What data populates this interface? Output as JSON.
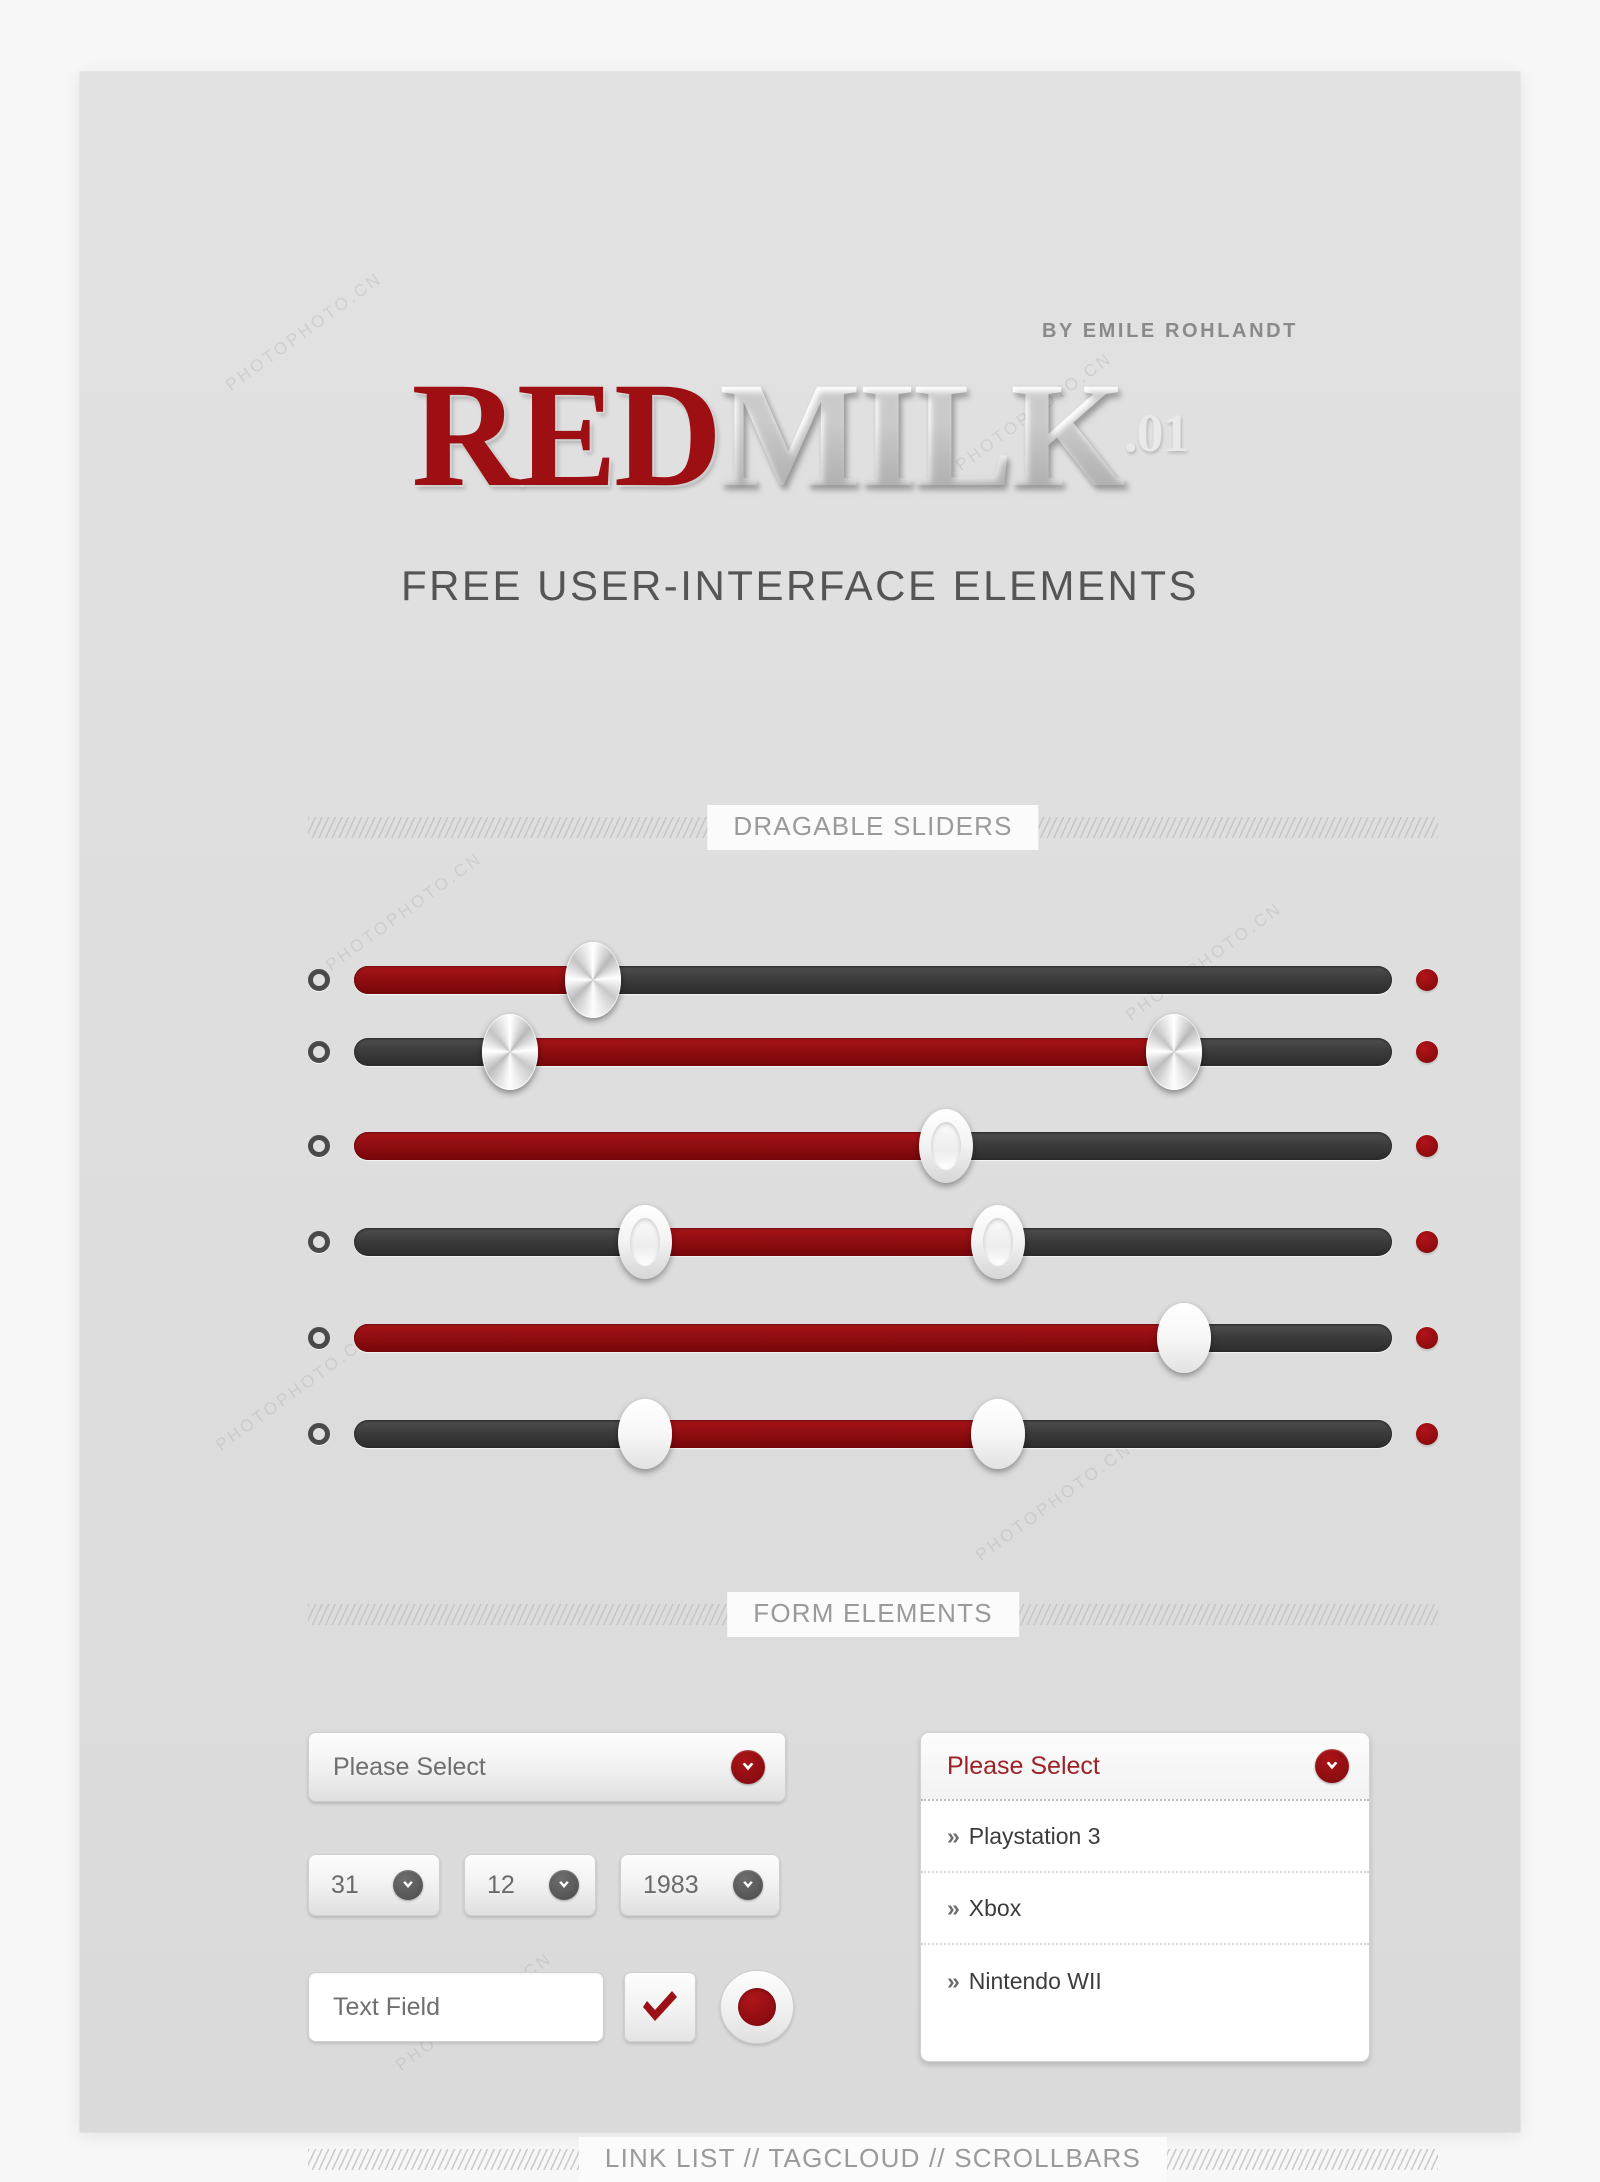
{
  "header": {
    "byline": "BY EMILE ROHLANDT",
    "logo_red": "RED",
    "logo_white": "MILK",
    "logo_version": ".01",
    "tagline": "FREE USER-INTERFACE ELEMENTS"
  },
  "sections": [
    {
      "label": "DRAGABLE SLIDERS"
    },
    {
      "label": "FORM ELEMENTS"
    },
    {
      "label": "LINK LIST // TAGCLOUD // SCROLLBARS"
    }
  ],
  "sliders": [
    {
      "name": "slider-metal-single",
      "handle_style": "metal",
      "type": "single",
      "fill_start_pct": 0,
      "fill_end_pct": 23,
      "handles_pct": [
        23
      ]
    },
    {
      "name": "slider-metal-range",
      "handle_style": "metal",
      "type": "range",
      "fill_start_pct": 15,
      "fill_end_pct": 79,
      "handles_pct": [
        15,
        79
      ]
    },
    {
      "name": "slider-ring-single",
      "handle_style": "ring",
      "type": "single",
      "fill_start_pct": 0,
      "fill_end_pct": 57,
      "handles_pct": [
        57
      ]
    },
    {
      "name": "slider-ring-range",
      "handle_style": "ring",
      "type": "range",
      "fill_start_pct": 28,
      "fill_end_pct": 62,
      "handles_pct": [
        28,
        62
      ]
    },
    {
      "name": "slider-solid-single",
      "handle_style": "solid",
      "type": "single",
      "fill_start_pct": 0,
      "fill_end_pct": 80,
      "handles_pct": [
        80
      ]
    },
    {
      "name": "slider-solid-range",
      "handle_style": "solid",
      "type": "range",
      "fill_start_pct": 28,
      "fill_end_pct": 62,
      "handles_pct": [
        28,
        62
      ]
    }
  ],
  "form": {
    "select_closed": {
      "value": "Please Select"
    },
    "select_open": {
      "header_value": "Please Select",
      "items": [
        {
          "marker": "»",
          "label": "Playstation 3"
        },
        {
          "marker": "»",
          "label": "Xbox"
        },
        {
          "marker": "»",
          "label": "Nintendo WII"
        }
      ]
    },
    "date": {
      "day": "31",
      "month": "12",
      "year": "1983"
    },
    "text_field": {
      "value": "Text Field",
      "placeholder": "Text Field"
    },
    "checkbox": {
      "checked": true
    },
    "radio": {
      "selected": true
    }
  },
  "colors": {
    "brand_red": "#8e0d11",
    "accent_red_dark": "#6d0608",
    "track_dark": "#3b3b3b",
    "page_bg": "#dedede",
    "text_gray": "#6f6f6f",
    "divider_gray": "#9a9a9a"
  },
  "watermark": {
    "text_a": "PHOTOPHOTO.CN",
    "text_b": "PHOTOPHOTO.CN"
  }
}
